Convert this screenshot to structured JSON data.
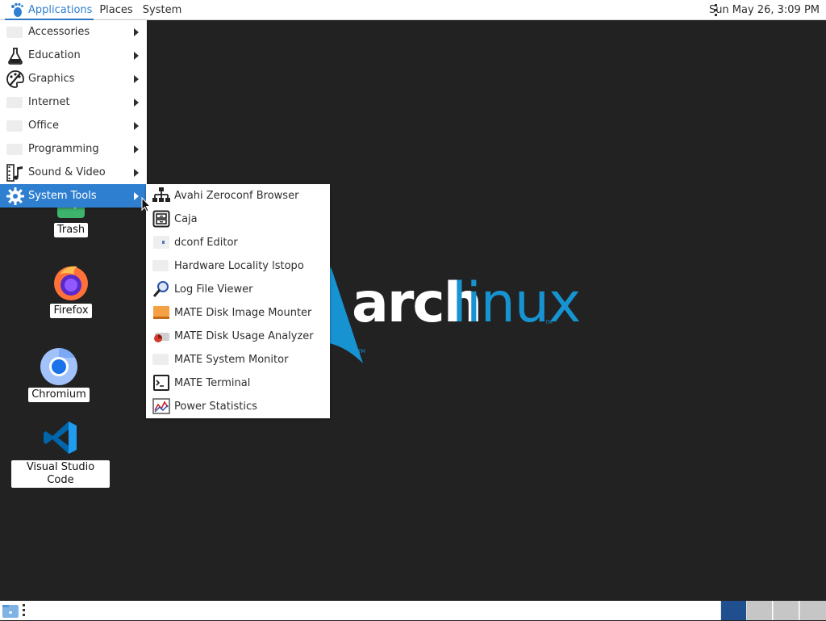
{
  "top_panel": {
    "menus": {
      "applications": "Applications",
      "places": "Places",
      "system": "System"
    },
    "clock": "Sun May 26,  3:09 PM"
  },
  "desktop": {
    "icons": [
      {
        "label": "Trash",
        "icon": "trash-icon"
      },
      {
        "label": "Firefox",
        "icon": "firefox-icon"
      },
      {
        "label": "Chromium",
        "icon": "chromium-icon"
      },
      {
        "label": "Visual Studio Code",
        "icon": "vscode-icon"
      }
    ],
    "wallpaper": {
      "word1": "arch",
      "word2": "linux",
      "tm": "TM"
    }
  },
  "apps_menu": {
    "items": [
      {
        "label": "Accessories",
        "icon": "accessories-icon"
      },
      {
        "label": "Education",
        "icon": "flask-icon"
      },
      {
        "label": "Graphics",
        "icon": "palette-icon"
      },
      {
        "label": "Internet",
        "icon": "internet-icon"
      },
      {
        "label": "Office",
        "icon": "office-icon"
      },
      {
        "label": "Programming",
        "icon": "programming-icon"
      },
      {
        "label": "Sound & Video",
        "icon": "film-music-icon"
      },
      {
        "label": "System Tools",
        "icon": "gear-icon",
        "active": true
      }
    ]
  },
  "system_tools_menu": {
    "items": [
      {
        "label": "Avahi Zeroconf Browser",
        "icon": "network-icon"
      },
      {
        "label": "Caja",
        "icon": "file-cabinet-icon"
      },
      {
        "label": "dconf Editor",
        "icon": "dconf-icon"
      },
      {
        "label": "Hardware Locality lstopo",
        "icon": "hardware-icon"
      },
      {
        "label": "Log File Viewer",
        "icon": "magnifier-icon"
      },
      {
        "label": "MATE Disk Image Mounter",
        "icon": "disk-image-icon"
      },
      {
        "label": "MATE Disk Usage Analyzer",
        "icon": "disk-usage-icon"
      },
      {
        "label": "MATE System Monitor",
        "icon": "system-monitor-icon"
      },
      {
        "label": "MATE Terminal",
        "icon": "terminal-icon"
      },
      {
        "label": "Power Statistics",
        "icon": "power-statistics-icon"
      }
    ]
  },
  "colors": {
    "accent": "#2f7fd1",
    "desktop": "#222222",
    "arch_blue": "#1793d1"
  }
}
